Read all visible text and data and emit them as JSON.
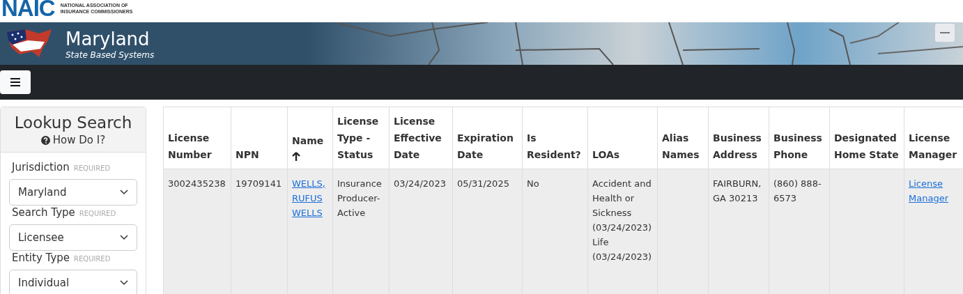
{
  "logo": {
    "mark": "NAIC",
    "org_lines": [
      "NATIONAL ASSOCIATION OF",
      "INSURANCE COMMISSIONERS"
    ]
  },
  "banner": {
    "title": "Maryland",
    "subtitle": "State Based Systems"
  },
  "sidebar": {
    "title": "Lookup Search",
    "help_link": "How Do I?",
    "fields": [
      {
        "label": "Jurisdiction",
        "required": "REQUIRED",
        "value": "Maryland"
      },
      {
        "label": "Search Type",
        "required": "REQUIRED",
        "value": "Licensee"
      },
      {
        "label": "Entity Type",
        "required": "REQUIRED",
        "value": "Individual"
      }
    ]
  },
  "table": {
    "columns": [
      {
        "label": "License Number",
        "sorted": false
      },
      {
        "label": "NPN",
        "sorted": false
      },
      {
        "label": "Name",
        "sorted": true
      },
      {
        "label": "License Type - Status",
        "sorted": false
      },
      {
        "label": "License Effective Date",
        "sorted": false
      },
      {
        "label": "Expiration Date",
        "sorted": false
      },
      {
        "label": "Is Resident?",
        "sorted": false
      },
      {
        "label": "LOAs",
        "sorted": false
      },
      {
        "label": "Alias Names",
        "sorted": false
      },
      {
        "label": "Business Address",
        "sorted": false
      },
      {
        "label": "Business Phone",
        "sorted": false
      },
      {
        "label": "Designated Home State",
        "sorted": false
      },
      {
        "label": "License Manager",
        "sorted": false
      }
    ],
    "rows": [
      {
        "cells": [
          {
            "kind": "text",
            "lines": [
              "3002435238"
            ]
          },
          {
            "kind": "text",
            "lines": [
              "19709141"
            ]
          },
          {
            "kind": "link",
            "lines": [
              "WELLS, RUFUS WELLS"
            ]
          },
          {
            "kind": "text",
            "lines": [
              "Insurance Producer-Active"
            ]
          },
          {
            "kind": "text",
            "lines": [
              "03/24/2023"
            ]
          },
          {
            "kind": "text",
            "lines": [
              "05/31/2025"
            ]
          },
          {
            "kind": "text",
            "lines": [
              "No"
            ]
          },
          {
            "kind": "text",
            "lines": [
              "Accident and Health or Sickness (03/24/2023)",
              "Life (03/24/2023)"
            ]
          },
          {
            "kind": "empty"
          },
          {
            "kind": "text",
            "lines": [
              "FAIRBURN, GA 30213"
            ]
          },
          {
            "kind": "text",
            "lines": [
              "(860) 888-6573"
            ]
          },
          {
            "kind": "empty"
          },
          {
            "kind": "link",
            "lines": [
              "License Manager"
            ]
          }
        ]
      }
    ]
  }
}
